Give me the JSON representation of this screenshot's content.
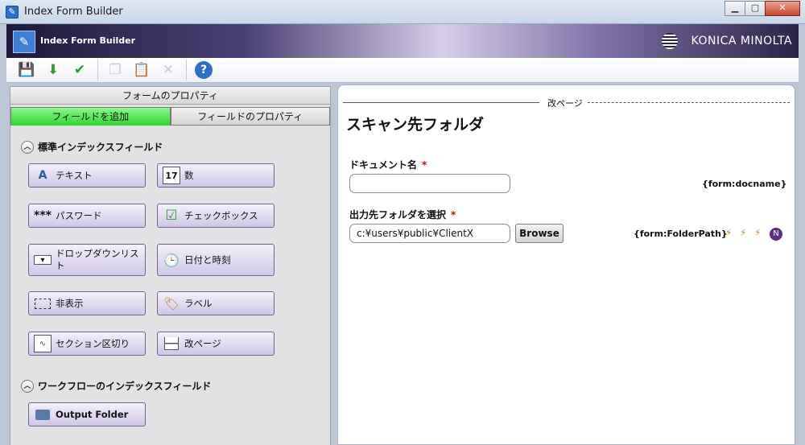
{
  "window": {
    "title": "Index Form Builder"
  },
  "header": {
    "app_name": "Index Form Builder",
    "brand": "KONICA MINOLTA"
  },
  "toolbar": {
    "icons": [
      "save-icon",
      "import-icon",
      "validate-icon",
      "copy-icon",
      "paste-icon",
      "delete-icon",
      "help-icon"
    ]
  },
  "left_panel": {
    "title": "フォームのプロパティ",
    "tabs": [
      "フィールドを追加",
      "フィールドのプロパティ"
    ],
    "standard_section": "標準インデックスフィールド",
    "standard_fields": [
      {
        "label": "テキスト",
        "icon": "text-icon"
      },
      {
        "label": "数",
        "icon": "number-icon"
      },
      {
        "label": "パスワード",
        "icon": "password-icon"
      },
      {
        "label": "チェックボックス",
        "icon": "checkbox-icon"
      },
      {
        "label": "ドロップダウンリスト",
        "icon": "dropdown-icon"
      },
      {
        "label": "日付と時刻",
        "icon": "datetime-icon"
      },
      {
        "label": "非表示",
        "icon": "hidden-icon"
      },
      {
        "label": "ラベル",
        "icon": "label-tag-icon"
      },
      {
        "label": "セクション区切り",
        "icon": "section-break-icon"
      },
      {
        "label": "改ページ",
        "icon": "page-break-icon"
      }
    ],
    "workflow_section": "ワークフローのインデックスフィールド",
    "workflow_fields": [
      {
        "label": "Output Folder",
        "icon": "folder-icon"
      }
    ]
  },
  "right_panel": {
    "page_break_label": "改ページ",
    "folder_title": "スキャン先フォルダ",
    "fields": [
      {
        "label": "ドキュメント名",
        "required": "*",
        "value": "",
        "token": "{form:docname}"
      },
      {
        "label": "出力先フォルダを選択",
        "required": "*",
        "value": "c:¥users¥public¥ClientX",
        "button": "Browse",
        "token": "{form:FolderPath}",
        "badge": "N"
      }
    ]
  }
}
